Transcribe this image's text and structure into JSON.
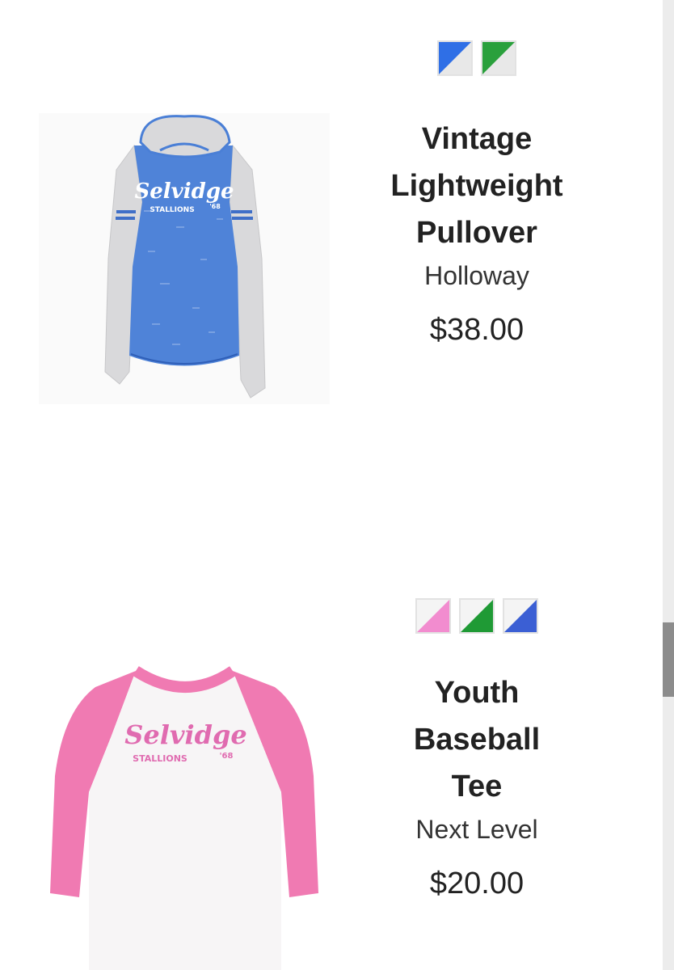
{
  "products": [
    {
      "name_lines": [
        "Vintage",
        "Lightweight",
        "Pullover"
      ],
      "brand": "Holloway",
      "price": "$38.00",
      "image": "vintage-pullover-image",
      "swatches": [
        {
          "color": "#2f6fe6",
          "name": "royal-heather"
        },
        {
          "color": "#2aa03c",
          "name": "kelly-heather"
        }
      ],
      "graphic_text": "Selvidge",
      "graphic_subtext": "STALLIONS",
      "graphic_year": "'68"
    },
    {
      "name_lines": [
        "Youth",
        "Baseball",
        "Tee"
      ],
      "brand": "Next Level",
      "price": "$20.00",
      "image": "youth-baseball-tee-image",
      "swatches": [
        {
          "color": "#f28ccf",
          "name": "pink"
        },
        {
          "color": "#1f9a35",
          "name": "green"
        },
        {
          "color": "#3b5fd4",
          "name": "royal"
        }
      ],
      "graphic_text": "Selvidge",
      "graphic_subtext": "STALLIONS",
      "graphic_year": "'68"
    }
  ]
}
